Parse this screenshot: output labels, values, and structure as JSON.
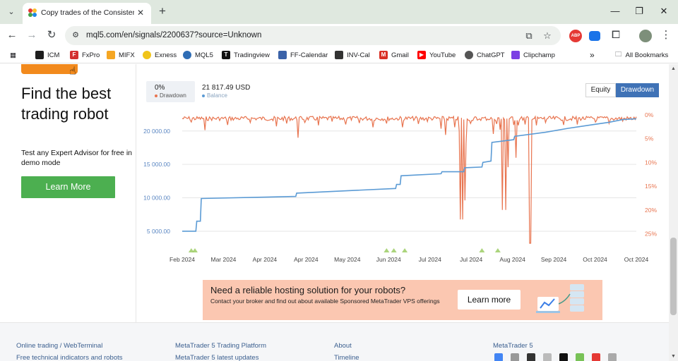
{
  "browser": {
    "tab_title": "Copy trades of the Consistent M",
    "url": "mql5.com/en/signals/2200637?source=Unknown",
    "bookmarks": [
      {
        "label": "ICM",
        "icon": "icm-icon",
        "color": "#1e1e1e"
      },
      {
        "label": "FxPro",
        "icon": "fxpro-icon",
        "color": "#d32f2f"
      },
      {
        "label": "MIFX",
        "icon": "mifx-icon",
        "color": "#f5a623"
      },
      {
        "label": "Exness",
        "icon": "exness-icon",
        "color": "#f0c419"
      },
      {
        "label": "MQL5",
        "icon": "mql5-icon",
        "color": "#2f6db5"
      },
      {
        "label": "Tradingview",
        "icon": "tradingview-icon",
        "color": "#111111"
      },
      {
        "label": "FF-Calendar",
        "icon": "ff-calendar-icon",
        "color": "#3b62a8"
      },
      {
        "label": "INV-Cal",
        "icon": "inv-cal-icon",
        "color": "#333333"
      },
      {
        "label": "Gmail",
        "icon": "gmail-icon",
        "color": "#d93025"
      },
      {
        "label": "YouTube",
        "icon": "youtube-icon",
        "color": "#ff0000"
      },
      {
        "label": "ChatGPT",
        "icon": "chatgpt-icon",
        "color": "#555555"
      },
      {
        "label": "Clipchamp",
        "icon": "clipchamp-icon",
        "color": "#7b3fe4"
      }
    ],
    "all_bookmarks": "All Bookmarks",
    "more": "»"
  },
  "sidebar": {
    "headline": "Find the best trading robot",
    "subtext": "Test any Expert Advisor for free in demo mode",
    "cta": "Learn More"
  },
  "chart_header": {
    "drawdown_value": "0%",
    "drawdown_label": "Drawdown",
    "balance_value": "21 817.49 USD",
    "balance_label": "Balance",
    "toggle_equity": "Equity",
    "toggle_drawdown": "Drawdown"
  },
  "colors": {
    "balance": "#5b9bd5",
    "drawdown": "#e8744f",
    "grid": "#e6e6e6",
    "axis_text": "#5a86c2",
    "active_toggle": "#3f72b6",
    "cta_green": "#4caf50",
    "deals_marker": "#9ccc65"
  },
  "chart_data": {
    "type": "line",
    "x_labels": [
      "Feb 2024",
      "Mar 2024",
      "Apr 2024",
      "Apr 2024",
      "May 2024",
      "Jun 2024",
      "Jul 2024",
      "Jul 2024",
      "Aug 2024",
      "Sep 2024",
      "Oct 2024",
      "Oct 2024"
    ],
    "x_range": [
      0,
      100
    ],
    "y_left": {
      "ticks": [
        "5 000.00",
        "10 000.00",
        "15 000.00",
        "20 000.00"
      ],
      "values": [
        5000,
        10000,
        15000,
        20000
      ],
      "range": [
        3200,
        22400
      ]
    },
    "y_right": {
      "ticks": [
        "0%",
        "5%",
        "10%",
        "15%",
        "20%",
        "25%"
      ],
      "values": [
        0,
        5,
        10,
        15,
        20,
        25
      ],
      "range": [
        0,
        27
      ]
    },
    "grid": true,
    "series": [
      {
        "name": "Balance",
        "axis": "left",
        "color": "#5b9bd5",
        "points": [
          [
            0,
            5000
          ],
          [
            3,
            5000
          ],
          [
            3.2,
            6500
          ],
          [
            4,
            6500
          ],
          [
            4.2,
            9900
          ],
          [
            25,
            10200
          ],
          [
            25.2,
            10700
          ],
          [
            47,
            11400
          ],
          [
            47.2,
            12000
          ],
          [
            48,
            12000
          ],
          [
            48.2,
            13300
          ],
          [
            57,
            13600
          ],
          [
            57.2,
            13900
          ],
          [
            62,
            13900
          ],
          [
            62.2,
            14500
          ],
          [
            66,
            14600
          ],
          [
            66.2,
            15300
          ],
          [
            68,
            15500
          ],
          [
            68.2,
            18300
          ],
          [
            73,
            18700
          ],
          [
            73.2,
            19200
          ],
          [
            80,
            19800
          ],
          [
            85,
            20400
          ],
          [
            90,
            20900
          ],
          [
            94,
            21300
          ],
          [
            97,
            21700
          ],
          [
            100,
            21817
          ]
        ]
      },
      {
        "name": "Drawdown",
        "axis": "right",
        "color": "#e8744f",
        "dense": true,
        "base": 0.3,
        "spikes": [
          [
            2,
            1.5
          ],
          [
            5,
            3.2
          ],
          [
            10,
            2.1
          ],
          [
            15,
            1.6
          ],
          [
            20,
            1.2
          ],
          [
            20.8,
            2.4
          ],
          [
            23,
            1.8
          ],
          [
            25.5,
            4.8
          ],
          [
            27,
            1.6
          ],
          [
            30,
            2.2
          ],
          [
            33,
            1.4
          ],
          [
            36,
            2.0
          ],
          [
            39,
            1.7
          ],
          [
            42,
            2.6
          ],
          [
            45,
            1.8
          ],
          [
            48.5,
            2.6
          ],
          [
            52,
            1.9
          ],
          [
            54,
            1.4
          ],
          [
            57,
            2.9
          ],
          [
            58,
            4.2
          ],
          [
            60,
            2.6
          ],
          [
            61,
            3.4
          ],
          [
            61.8,
            8.5
          ],
          [
            62.6,
            6.0
          ],
          [
            63.5,
            1.8
          ],
          [
            64,
            1.2
          ],
          [
            65,
            1.1
          ],
          [
            68.5,
            4.0
          ],
          [
            69.3,
            1.9
          ],
          [
            70,
            3.1
          ],
          [
            73,
            2.1
          ],
          [
            73.5,
            9.0
          ],
          [
            74,
            2.2
          ],
          [
            75.5,
            2.0
          ],
          [
            76.8,
            27.0
          ],
          [
            78,
            2.2
          ],
          [
            80,
            1.6
          ],
          [
            84,
            2.1
          ],
          [
            87,
            2.0
          ],
          [
            91,
            1.5
          ],
          [
            94,
            1.8
          ],
          [
            97,
            1.3
          ]
        ],
        "deep": [
          [
            61.2,
            22.0
          ],
          [
            61.8,
            22.0
          ],
          [
            62.3,
            18.0
          ],
          [
            70.6,
            20.0
          ],
          [
            71.2,
            20.0
          ],
          [
            71.8,
            11.0
          ],
          [
            76.4,
            27.0
          ]
        ]
      }
    ],
    "deal_markers_x": [
      2,
      2.8,
      45,
      46.6,
      49,
      66,
      69.5
    ]
  },
  "hosting_banner": {
    "title": "Need a reliable hosting solution for your robots?",
    "text": "Contact your broker and find out about available Sponsored MetaTrader VPS offerings",
    "button": "Learn more"
  },
  "footer": {
    "col1": [
      "Online trading / WebTerminal",
      "Free technical indicators and robots"
    ],
    "col2": [
      "MetaTrader 5 Trading Platform",
      "MetaTrader 5 latest updates"
    ],
    "col3": [
      "About",
      "Timeline"
    ],
    "col4": [
      "MetaTrader 5"
    ]
  }
}
